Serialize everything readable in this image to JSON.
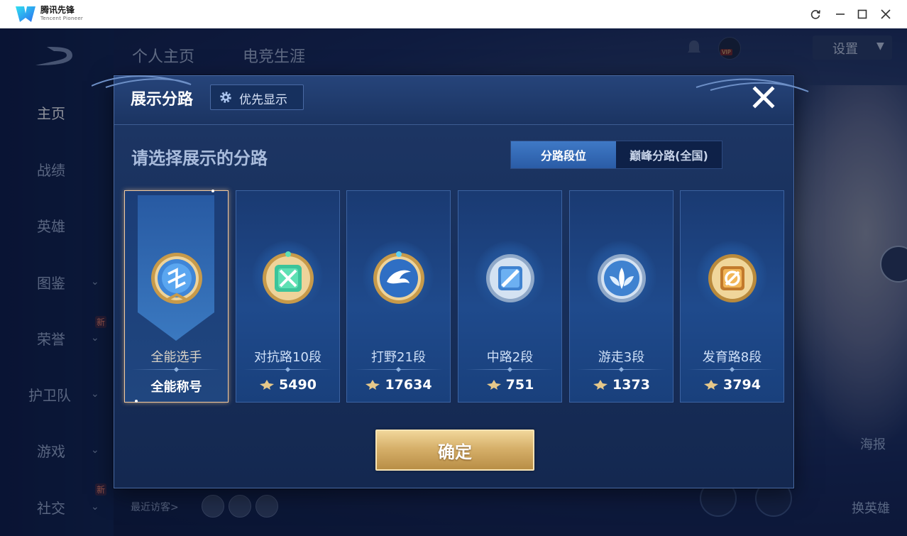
{
  "window": {
    "app_name": "腾讯先锋",
    "app_subtitle": "Tencent Pioneer"
  },
  "background": {
    "top_nav": [
      "个人主页",
      "电竞生涯"
    ],
    "sidebar": [
      {
        "label": "主页",
        "active": true
      },
      {
        "label": "战绩"
      },
      {
        "label": "英雄"
      },
      {
        "label": "图鉴",
        "has_chevron": true
      },
      {
        "label": "荣誉",
        "has_chevron": true,
        "badge": "新"
      },
      {
        "label": "护卫队",
        "has_chevron": true
      },
      {
        "label": "游戏",
        "has_chevron": true
      },
      {
        "label": "社交",
        "has_chevron": true,
        "badge": "新"
      }
    ],
    "settings_label": "设置",
    "vip_label": "VIP",
    "recent_visitors": "最近访客>",
    "right_labels": [
      "海报",
      "换英雄"
    ]
  },
  "modal": {
    "title": "展示分路",
    "priority_button": "优先显示",
    "prompt": "请选择展示的分路",
    "tabs": [
      "分路段位",
      "巅峰分路(全国)"
    ],
    "active_tab": 0,
    "lanes": [
      {
        "name": "全能选手",
        "value": "全能称号",
        "selected": true,
        "emblem": "all-round-emblem"
      },
      {
        "name": "对抗路10段",
        "score": "5490",
        "emblem": "clash-lane-emblem"
      },
      {
        "name": "打野21段",
        "score": "17634",
        "emblem": "jungle-emblem"
      },
      {
        "name": "中路2段",
        "score": "751",
        "emblem": "mid-lane-emblem"
      },
      {
        "name": "游走3段",
        "score": "1373",
        "emblem": "roam-emblem"
      },
      {
        "name": "发育路8段",
        "score": "3794",
        "emblem": "farm-lane-emblem"
      }
    ],
    "confirm": "确定"
  },
  "colors": {
    "accent_blue": "#2a5ca6",
    "gold": "#d6b06a",
    "selected_border": "#f2caa0"
  }
}
